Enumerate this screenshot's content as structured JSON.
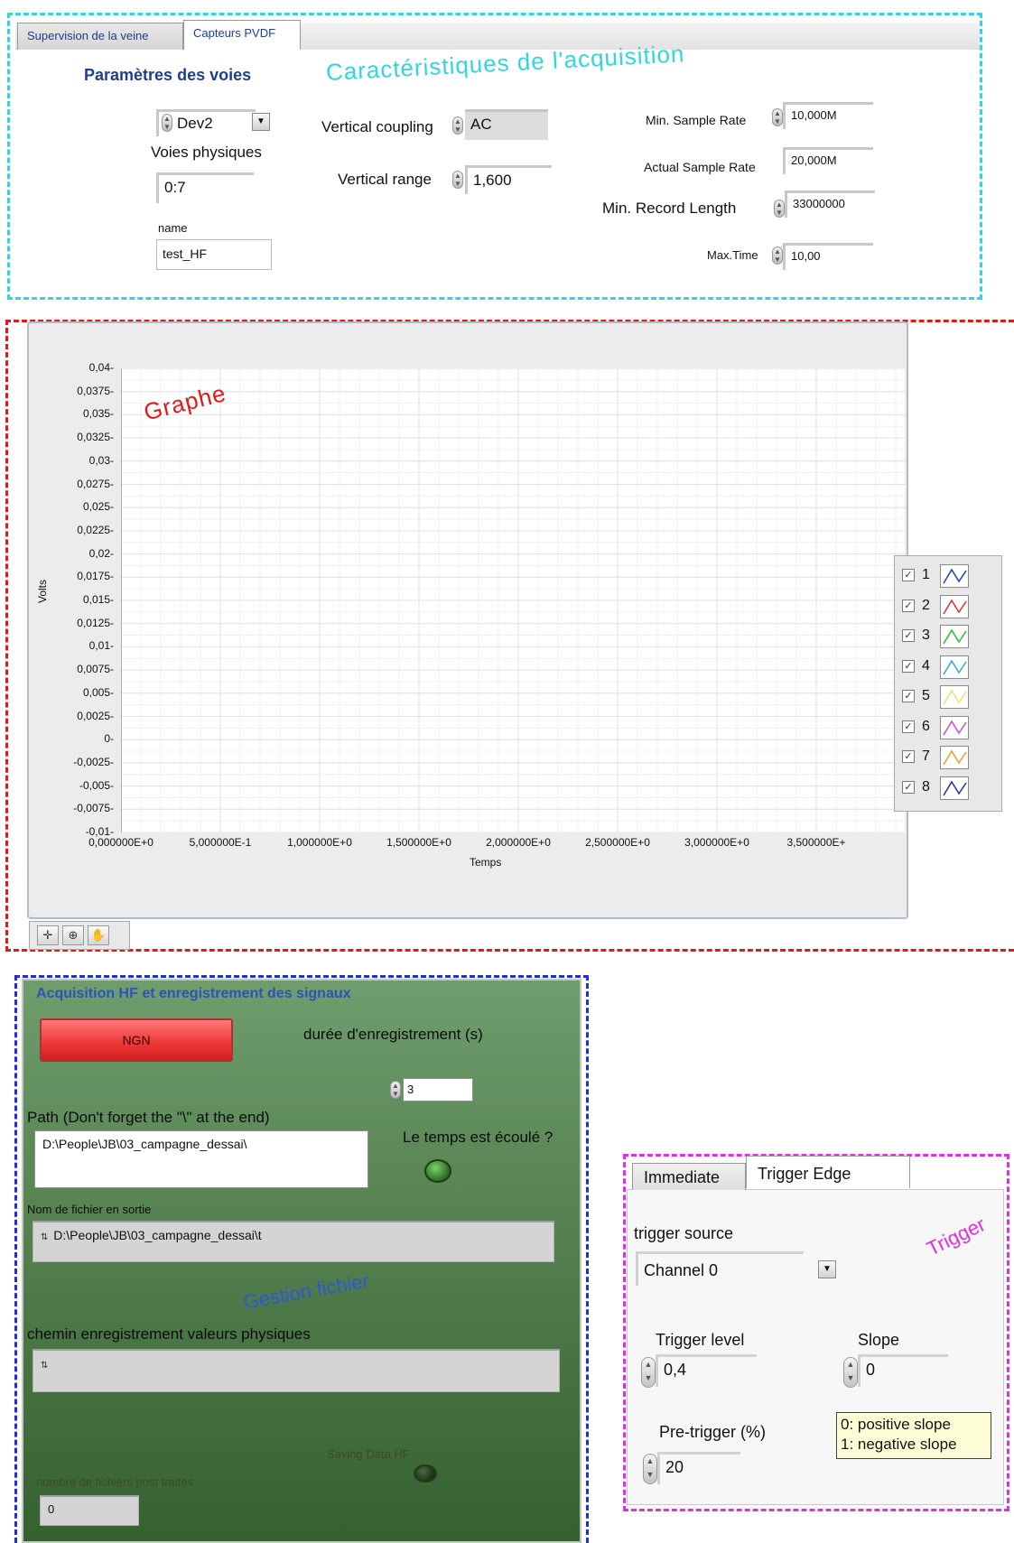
{
  "acquisition": {
    "tabs": [
      "Supervision de la veine",
      "Capteurs PVDF"
    ],
    "active_tab": "Capteurs PVDF",
    "params_title": "Paramètres des voies",
    "device_value": "Dev2",
    "voies_label": "Voies physiques",
    "voies_value": "0:7",
    "name_label": "name",
    "name_value": "test_HF",
    "annotation": "Caractéristiques de l'acquisition",
    "vertical_coupling_label": "Vertical coupling",
    "vertical_coupling_value": "AC",
    "vertical_range_label": "Vertical range",
    "vertical_range_value": "1,600",
    "min_sample_rate_label": "Min. Sample Rate",
    "min_sample_rate_value": "10,000M",
    "actual_sample_rate_label": "Actual Sample Rate",
    "actual_sample_rate_value": "20,000M",
    "min_record_length_label": "Min. Record Length",
    "min_record_length_value": "33000000",
    "max_time_label": "Max.Time",
    "max_time_value": "10,00"
  },
  "graph": {
    "annotation": "Graphe",
    "legend": [
      {
        "label": "1",
        "checked": true,
        "color": "#1f3fbf"
      },
      {
        "label": "2",
        "checked": true,
        "color": "#e03030"
      },
      {
        "label": "3",
        "checked": true,
        "color": "#1fbf2f"
      },
      {
        "label": "4",
        "checked": true,
        "color": "#3fa0e0"
      },
      {
        "label": "5",
        "checked": true,
        "color": "#e6e07a"
      },
      {
        "label": "6",
        "checked": true,
        "color": "#c050d0"
      },
      {
        "label": "7",
        "checked": true,
        "color": "#e0a020"
      },
      {
        "label": "8",
        "checked": true,
        "color": "#2030a0"
      }
    ],
    "palette_icons": [
      "cursor-cross-icon",
      "zoom-icon",
      "pan-hand-icon"
    ]
  },
  "chart_data": {
    "type": "line",
    "xlabel": "Temps",
    "ylabel": "Volts",
    "x_ticks": [
      "0,000000E+0",
      "5,000000E-1",
      "1,000000E+0",
      "1,500000E+0",
      "2,000000E+0",
      "2,500000E+0",
      "3,000000E+0",
      "3,500000E+"
    ],
    "y_ticks": [
      "0,04",
      "0,0375",
      "0,035",
      "0,0325",
      "0,03",
      "0,0275",
      "0,025",
      "0,0225",
      "0,02",
      "0,0175",
      "0,015",
      "0,0125",
      "0,01",
      "0,0075",
      "0,005",
      "0,0025",
      "0",
      "-0,0025",
      "-0,005",
      "-0,0075",
      "-0,01"
    ],
    "xlim": [
      0,
      3.5
    ],
    "ylim": [
      -0.01,
      0.04
    ],
    "grid": true,
    "legend_placement": "right",
    "series": []
  },
  "hf": {
    "title": "Acquisition HF et enregistrement des signaux",
    "button_label": "NGN",
    "duree_label": "durée  d'enregistrement (s)",
    "duree_value": "3",
    "path_label": "Path (Don't forget the \"\\\" at the end)",
    "path_value": "D:\\People\\JB\\03_campagne_dessai\\",
    "temps_label": "Le temps est écoulé ?",
    "nom_label": "Nom de fichier en sortie",
    "nom_value": "D:\\People\\JB\\03_campagne_dessai\\t",
    "annotation": "Gestion fichier",
    "chemin_label": "chemin enregistrement valeurs physiques",
    "chemin_value": "",
    "saving_label": "Saving Data HF",
    "nombre_label": "nombre de fichiers post traites",
    "nombre_value": "0"
  },
  "trigger": {
    "tabs": [
      "Immediate",
      "Trigger Edge"
    ],
    "active_tab": "Trigger Edge",
    "annotation": "Trigger",
    "source_label": "trigger source",
    "source_value": "Channel 0",
    "level_label": "Trigger level",
    "level_value": "0,4",
    "slope_label": "Slope",
    "slope_value": "0",
    "pretrigger_label": "Pre-trigger (%)",
    "pretrigger_value": "20",
    "slope_hint_line1": "0: positive slope",
    "slope_hint_line2": "1: negative slope"
  }
}
